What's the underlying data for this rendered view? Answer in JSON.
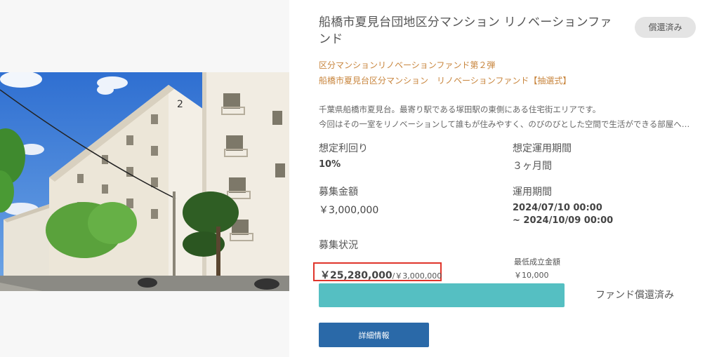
{
  "fund": {
    "title": "船橋市夏見台団地区分マンション リノベーションファンド",
    "status_badge": "償還済み",
    "subtitle1": "区分マンションリノベーションファンド第２弾",
    "subtitle2": "船橋市夏見台区分マンション　リノベーションファンド【抽選式】",
    "description1": "千葉県船橋市夏見台。最寄り駅である塚田駅の東側にある住宅街エリアです。",
    "description2": "今回はその一室をリノベーションして誰もが住みやすく、のびのびとした空間で生活ができる部屋へ生まれ変わらせます。",
    "expected_yield_label": "想定利回り",
    "expected_yield_value": "10%",
    "expected_period_label": "想定運用期間",
    "expected_period_value": "３ヶ月間",
    "raise_amount_label": "募集金額",
    "raise_amount_value": "￥3,000,000",
    "operation_period_label": "運用期間",
    "operation_period_start": "2024/07/10 00:00",
    "operation_period_end": "~ 2024/10/09 00:00",
    "recruit_status_label": "募集状況",
    "applied_amount": "￥25,280,000",
    "target_amount": "/￥3,000,000",
    "min_amount_label": "最低成立金額",
    "min_amount_value": "￥10,000",
    "progress_percent": 100,
    "progress_status": "ファンド償還済み",
    "detail_button": "詳細情報",
    "building_number": "2"
  },
  "colors": {
    "accent_orange": "#c8853d",
    "progress_fill": "#55bfc2",
    "button_blue": "#2a69a8",
    "highlight_red": "#e0352b"
  }
}
